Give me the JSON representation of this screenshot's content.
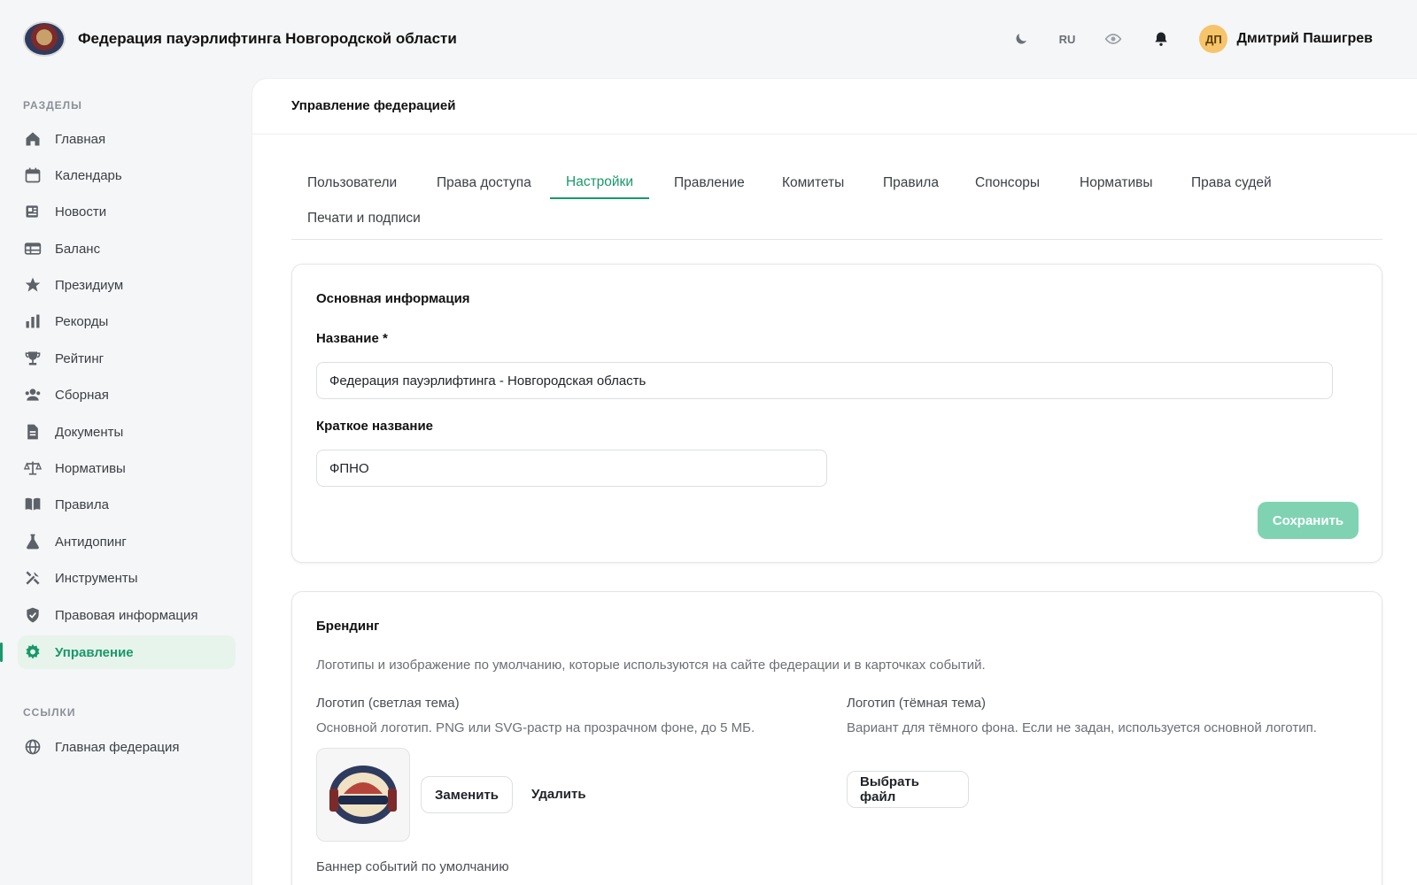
{
  "header": {
    "title": "Федерация пауэрлифтинга Новгородской области",
    "lang": "RU",
    "user_initials": "ДП",
    "user_name": "Дмитрий Пашигрев"
  },
  "sidebar": {
    "sections_label": "РАЗДЕЛЫ",
    "items": [
      {
        "label": "Главная",
        "icon": "home-icon"
      },
      {
        "label": "Календарь",
        "icon": "calendar-icon"
      },
      {
        "label": "Новости",
        "icon": "news-icon"
      },
      {
        "label": "Баланс",
        "icon": "table-icon"
      },
      {
        "label": "Президиум",
        "icon": "star-icon"
      },
      {
        "label": "Рекорды",
        "icon": "bar-chart-icon"
      },
      {
        "label": "Рейтинг",
        "icon": "trophy-icon"
      },
      {
        "label": "Сборная",
        "icon": "users-icon"
      },
      {
        "label": "Документы",
        "icon": "document-icon"
      },
      {
        "label": "Нормативы",
        "icon": "scale-icon"
      },
      {
        "label": "Правила",
        "icon": "book-icon"
      },
      {
        "label": "Антидопинг",
        "icon": "flask-icon"
      },
      {
        "label": "Инструменты",
        "icon": "tools-icon"
      },
      {
        "label": "Правовая информация",
        "icon": "shield-icon"
      },
      {
        "label": "Управление",
        "icon": "gear-icon",
        "active": true
      }
    ],
    "links_label": "ССЫЛКИ",
    "links": [
      {
        "label": "Главная федерация",
        "icon": "globe-icon"
      }
    ]
  },
  "main": {
    "title": "Управление федерацией",
    "tabs": [
      {
        "label": "Пользователи"
      },
      {
        "label": "Права доступа"
      },
      {
        "label": "Настройки",
        "active": true
      },
      {
        "label": "Правление"
      },
      {
        "label": "Комитеты"
      },
      {
        "label": "Правила"
      },
      {
        "label": "Спонсоры"
      },
      {
        "label": "Нормативы"
      },
      {
        "label": "Права судей"
      },
      {
        "label": "Печати и подписи"
      }
    ],
    "basic": {
      "title": "Основная информация",
      "name_label": "Название *",
      "name_value": "Федерация пауэрлифтинга - Новгородская область",
      "short_label": "Краткое название",
      "short_value": "ФПНО",
      "save_label": "Сохранить"
    },
    "branding": {
      "title": "Брендинг",
      "description": "Логотипы и изображение по умолчанию, которые используются на сайте федерации и в карточках событий.",
      "logo_light_label": "Логотип (светлая тема)",
      "logo_light_hint": "Основной логотип. PNG или SVG-растр на прозрачном фоне, до 5 МБ.",
      "replace_label": "Заменить",
      "delete_label": "Удалить",
      "logo_dark_label": "Логотип (тёмная тема)",
      "logo_dark_hint": "Вариант для тёмного фона. Если не задан, используется основной логотип.",
      "choose_file_label": "Выбрать файл",
      "banner_label": "Баннер событий по умолчанию"
    }
  },
  "colors": {
    "accent": "#19986a",
    "accent_light": "#e6f4ec",
    "save_disabled": "#7fd3b3"
  }
}
